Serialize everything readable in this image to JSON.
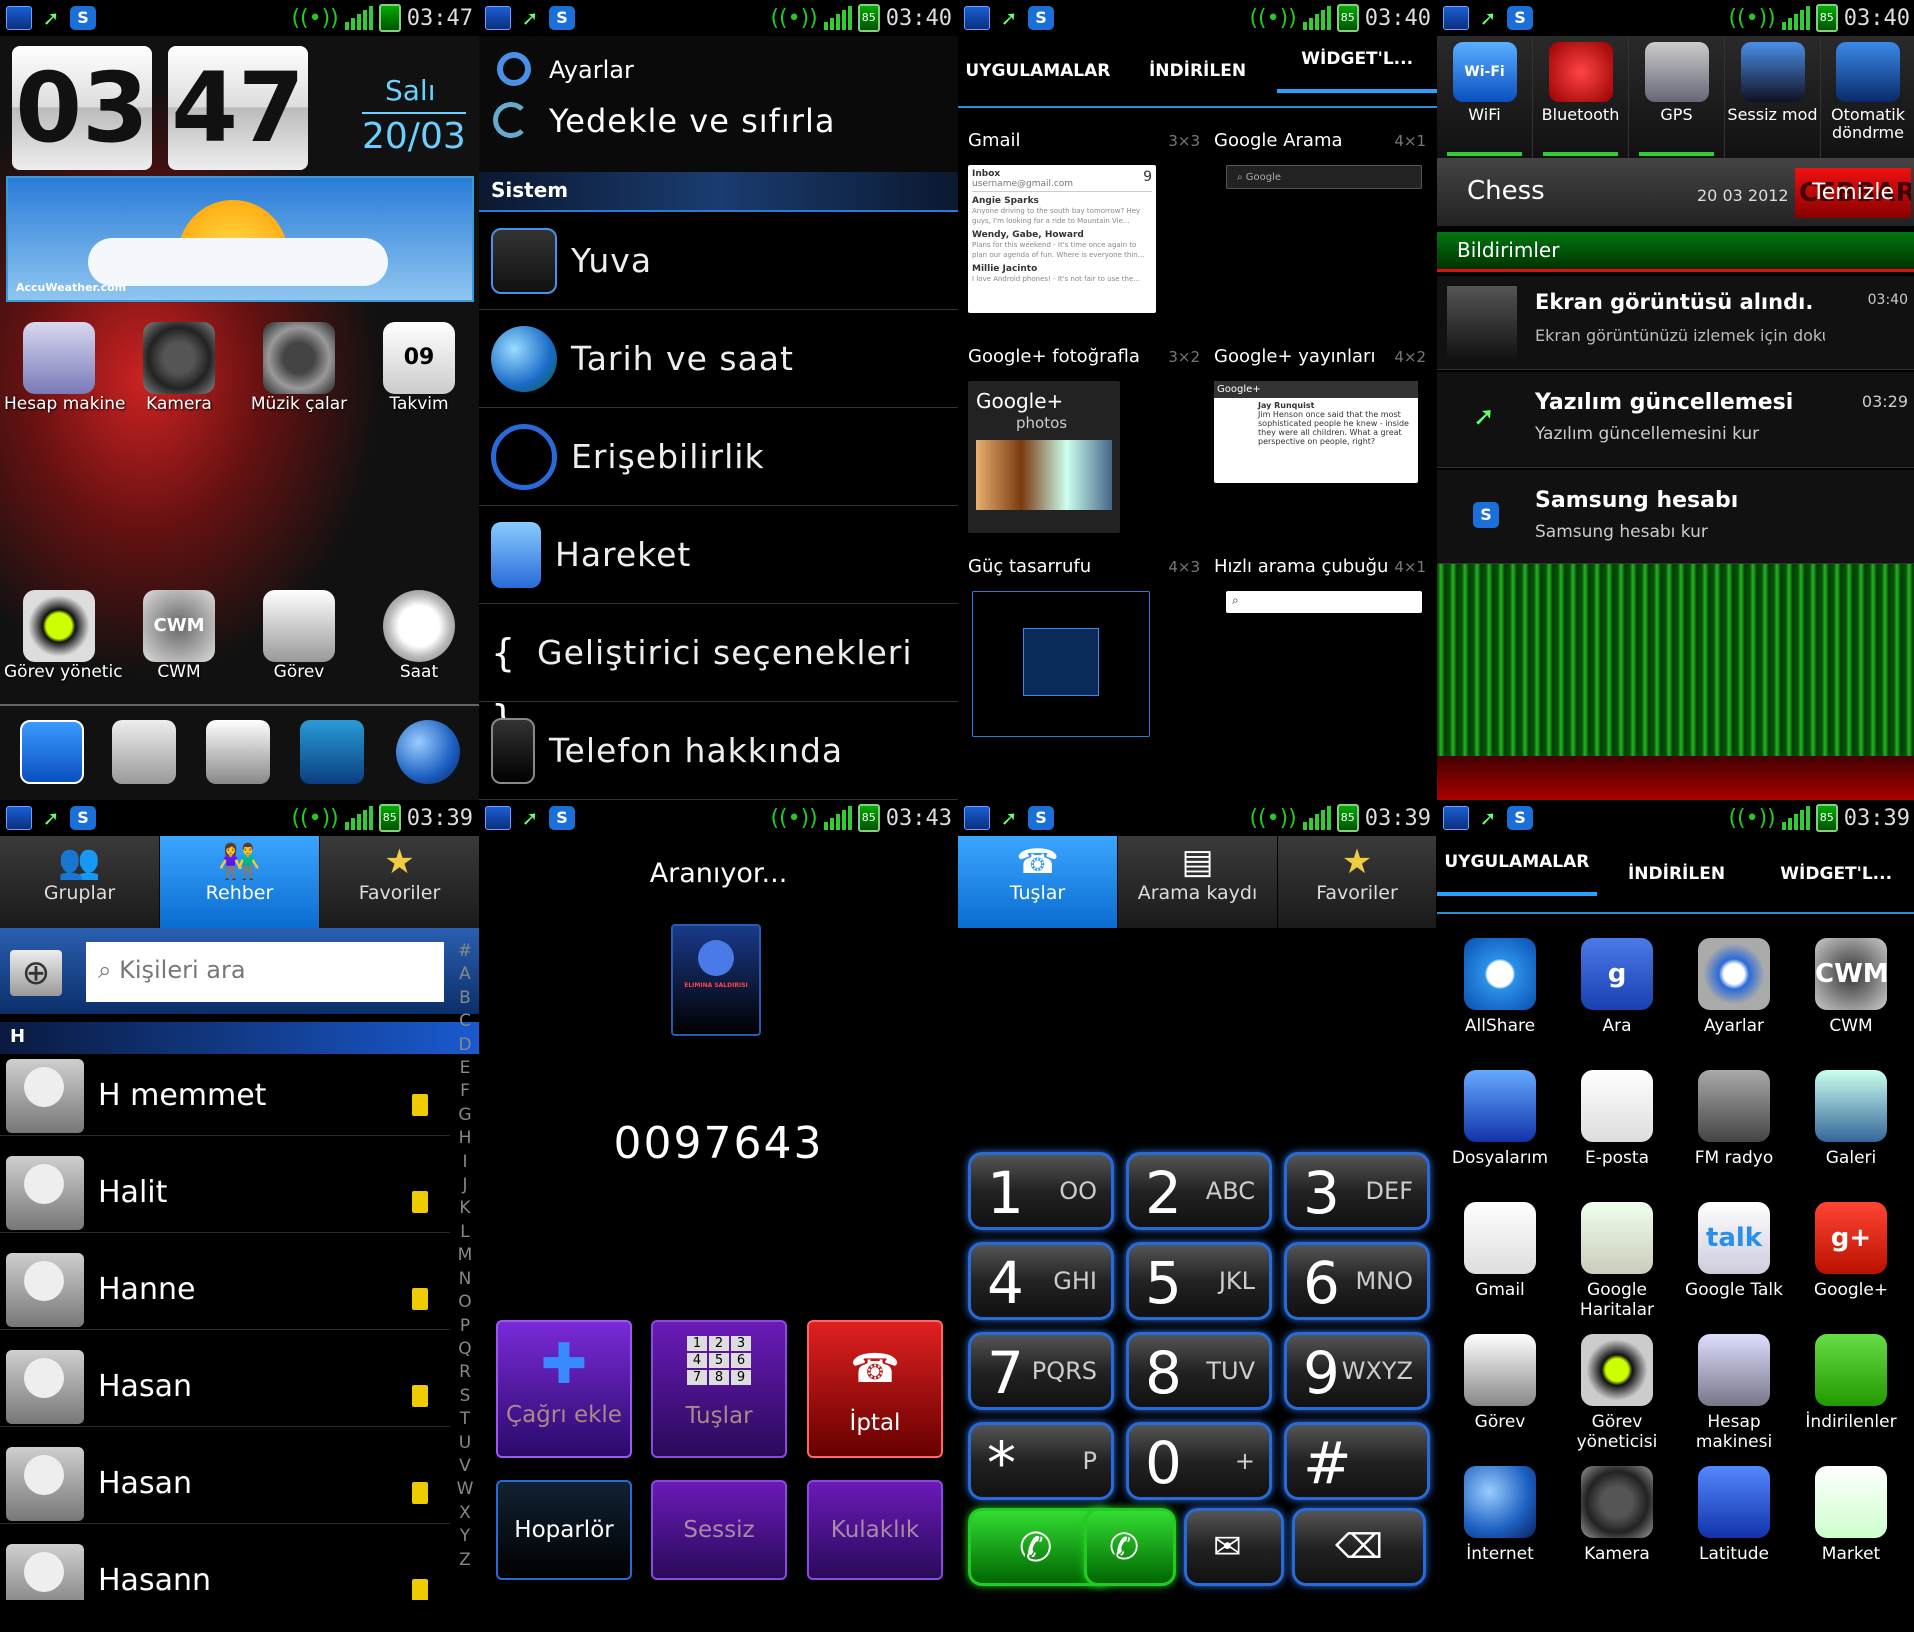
{
  "status_bars": [
    {
      "time": "03:47",
      "battery": ""
    },
    {
      "time": "03:40",
      "battery": "85"
    },
    {
      "time": "03:40",
      "battery": "85"
    },
    {
      "time": "03:40",
      "battery": "85"
    },
    {
      "time": "03:39",
      "battery": "85"
    },
    {
      "time": "03:43",
      "battery": "85"
    },
    {
      "time": "03:39",
      "battery": "85"
    },
    {
      "time": "03:39",
      "battery": "85"
    }
  ],
  "home": {
    "clock_hour": "03",
    "clock_min": "47",
    "day": "Salı",
    "date": "20/03",
    "weather_brand": "AccuWeather.com",
    "apps_row1": [
      "Hesap makine",
      "Kamera",
      "Müzik çalar",
      "Takvim"
    ],
    "calendar_day": "09",
    "apps_row2": [
      "Görev yönetic",
      "CWM",
      "Görev",
      "Saat"
    ],
    "cwm_icon_text": "CWM"
  },
  "settings": {
    "title": "Ayarlar",
    "backup": "Yedekle ve sıfırla",
    "section": "Sistem",
    "items": [
      "Yuva",
      "Tarih ve saat",
      "Erişebilirlik",
      "Hareket",
      "Geliştirici seçenekleri",
      "Telefon hakkında"
    ],
    "dev_icon": "{ }"
  },
  "widgets": {
    "tabs": [
      "UYGULAMALAR",
      "İNDİRİLEN",
      "WİDGET'L..."
    ],
    "items": [
      {
        "name": "Gmail",
        "size": "3×3"
      },
      {
        "name": "Google Arama",
        "size": "4×1"
      },
      {
        "name": "Google+ fotoğrafla",
        "size": "3×2"
      },
      {
        "name": "Google+ yayınları",
        "size": "4×2"
      },
      {
        "name": "Güç tasarrufu",
        "size": "4×3"
      },
      {
        "name": "Hızlı arama çubuğu",
        "size": "4×1"
      }
    ],
    "gmail_preview": {
      "inbox": "Inbox",
      "account": "username@gmail.com",
      "count": "9",
      "rows": [
        {
          "from": "Angie Sparks",
          "text": "Anyone driving to the south bay tomorrow? Hey guys, I'm looking for a ride to Mountain Vie..."
        },
        {
          "from": "Wendy, Gabe, Howard",
          "text": "Plans for this weekend - It's time once again to plan our agenda of fun. Where is everyone thin..."
        },
        {
          "from": "Millie Jacinto",
          "text": "I love Android phones! - It's not fair to use the..."
        }
      ]
    },
    "search_hint": "Google",
    "gplus_photos": {
      "brand": "Google+",
      "sub": "photos"
    },
    "gplus_stream": {
      "brand": "Google+",
      "author": "Jay Runquist",
      "text": "Jim Henson once said that the most sophisticated people he knew - inside they were all children. What a great perspective on people, right?"
    }
  },
  "notifications": {
    "toggles": [
      "WiFi",
      "Bluetooth",
      "GPS",
      "Sessiz mod",
      "Otomatik döndrme"
    ],
    "wifi_icon": "Wi-Fi",
    "chess": "Chess",
    "chess_date": "20 03 2012",
    "clear": "Temizle",
    "clear_bg_text": "CEBBAR",
    "header": "Bildirimler",
    "items": [
      {
        "title": "Ekran görüntüsü alındı.",
        "sub": "Ekran görüntünüzü izlemek için dokunun",
        "time": "03:40"
      },
      {
        "title": "Yazılım güncellemesi",
        "sub": "Yazılım güncellemesini kur",
        "time": "03:29"
      },
      {
        "title": "Samsung hesabı",
        "sub": "Samsung hesabı kur",
        "time": ""
      }
    ]
  },
  "contacts": {
    "tabs": [
      "Gruplar",
      "Rehber",
      "Favoriler"
    ],
    "search_placeholder": "Kişileri ara",
    "section_letter": "H",
    "names": [
      "H memmet",
      "Halit",
      "Hanne",
      "Hasan",
      "Hasan",
      "Hasann"
    ],
    "alphabet": [
      "#",
      "A",
      "B",
      "C",
      "D",
      "E",
      "F",
      "G",
      "H",
      "I",
      "J",
      "K",
      "L",
      "M",
      "N",
      "O",
      "P",
      "Q",
      "R",
      "S",
      "T",
      "U",
      "V",
      "W",
      "X",
      "Y",
      "Z"
    ]
  },
  "call": {
    "status": "Aranıyor...",
    "number": "0097643",
    "image_caption": "ELIMINA SALDIRISI",
    "buttons": [
      "Çağrı ekle",
      "Tuşlar",
      "İptal",
      "Hoparlör",
      "Sessiz",
      "Kulaklık"
    ],
    "keypad_digits": [
      "1",
      "2",
      "3",
      "4",
      "5",
      "6",
      "7",
      "8",
      "9"
    ]
  },
  "dialer": {
    "tabs": [
      "Tuşlar",
      "Arama kaydı",
      "Favoriler"
    ],
    "keys": [
      {
        "n": "1",
        "l": "OO"
      },
      {
        "n": "2",
        "l": "ABC"
      },
      {
        "n": "3",
        "l": "DEF"
      },
      {
        "n": "4",
        "l": "GHI"
      },
      {
        "n": "5",
        "l": "JKL"
      },
      {
        "n": "6",
        "l": "MNO"
      },
      {
        "n": "7",
        "l": "PQRS"
      },
      {
        "n": "8",
        "l": "TUV"
      },
      {
        "n": "9",
        "l": "WXYZ"
      },
      {
        "n": "*",
        "l": "P"
      },
      {
        "n": "0",
        "l": "+"
      },
      {
        "n": "#",
        "l": ""
      }
    ]
  },
  "drawer": {
    "tabs": [
      "UYGULAMALAR",
      "İNDİRİLEN",
      "WİDGET'L..."
    ],
    "apps": [
      "AllShare",
      "Ara",
      "Ayarlar",
      "CWM",
      "Dosyalarım",
      "E-posta",
      "FM radyo",
      "Galeri",
      "Gmail",
      "Google Haritalar",
      "Google Talk",
      "Google+",
      "Görev",
      "Görev yöneticisi",
      "Hesap makinesi",
      "İndirilenler",
      "İnternet",
      "Kamera",
      "Latitude",
      "Market"
    ],
    "icon_texts": {
      "ara": "g",
      "talk": "talk",
      "gplus": "g+",
      "cwm": "CWM"
    }
  },
  "colors": {
    "accent": "#2a9fff",
    "green": "#33cc33",
    "red": "#d01010",
    "purple": "#6a14b0"
  }
}
